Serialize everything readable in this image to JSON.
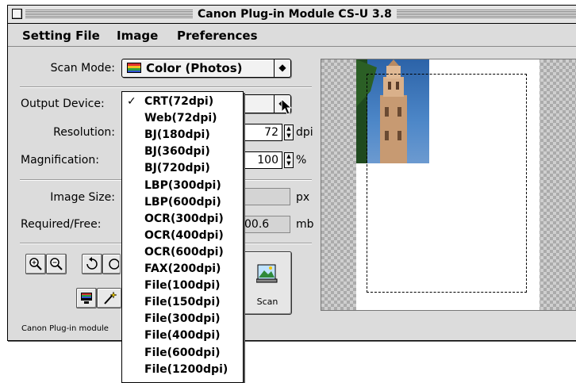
{
  "window": {
    "title": "Canon Plug-in Module CS-U 3.8"
  },
  "menubar": {
    "items": [
      "Setting File",
      "Image",
      "Preferences"
    ]
  },
  "scan_mode": {
    "label": "Scan Mode:",
    "value": "Color (Photos)"
  },
  "output_device": {
    "label": "Output Device:"
  },
  "resolution": {
    "label": "Resolution:",
    "value": "72",
    "unit": "dpi"
  },
  "magnification": {
    "label": "Magnification:",
    "value": "100",
    "unit": "%"
  },
  "image_size": {
    "label": "Image Size:",
    "unit": "px"
  },
  "required_free": {
    "label": "Required/Free:",
    "value": "00.6",
    "unit": "mb"
  },
  "scan_button": {
    "label": "Scan"
  },
  "status_text": "Canon Plug-in module",
  "dropdown": {
    "selected": "CRT(72dpi)",
    "options": [
      "CRT(72dpi)",
      "Web(72dpi)",
      "BJ(180dpi)",
      "BJ(360dpi)",
      "BJ(720dpi)",
      "LBP(300dpi)",
      "LBP(600dpi)",
      "OCR(300dpi)",
      "OCR(400dpi)",
      "OCR(600dpi)",
      "FAX(200dpi)",
      "File(100dpi)",
      "File(150dpi)",
      "File(300dpi)",
      "File(400dpi)",
      "File(600dpi)",
      "File(1200dpi)"
    ]
  },
  "icons": [
    "zoom-in-icon",
    "zoom-out-icon",
    "rotate-left-icon",
    "rotate-right-icon",
    "monitor-icon",
    "magic-wand-icon",
    "scan-preview-icon",
    "arrow-cursor-icon"
  ]
}
